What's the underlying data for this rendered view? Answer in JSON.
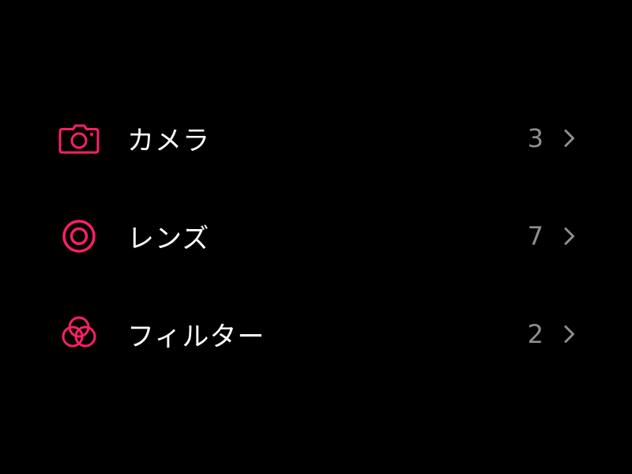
{
  "colors": {
    "background": "#000000",
    "accent": "#ff1f66",
    "label": "#ffffff",
    "count": "#8e8e93",
    "chevron": "#8e8e93"
  },
  "items": [
    {
      "icon": "camera-icon",
      "label": "カメラ",
      "count": "3"
    },
    {
      "icon": "lens-icon",
      "label": "レンズ",
      "count": "7"
    },
    {
      "icon": "filter-icon",
      "label": "フィルター",
      "count": "2"
    }
  ]
}
